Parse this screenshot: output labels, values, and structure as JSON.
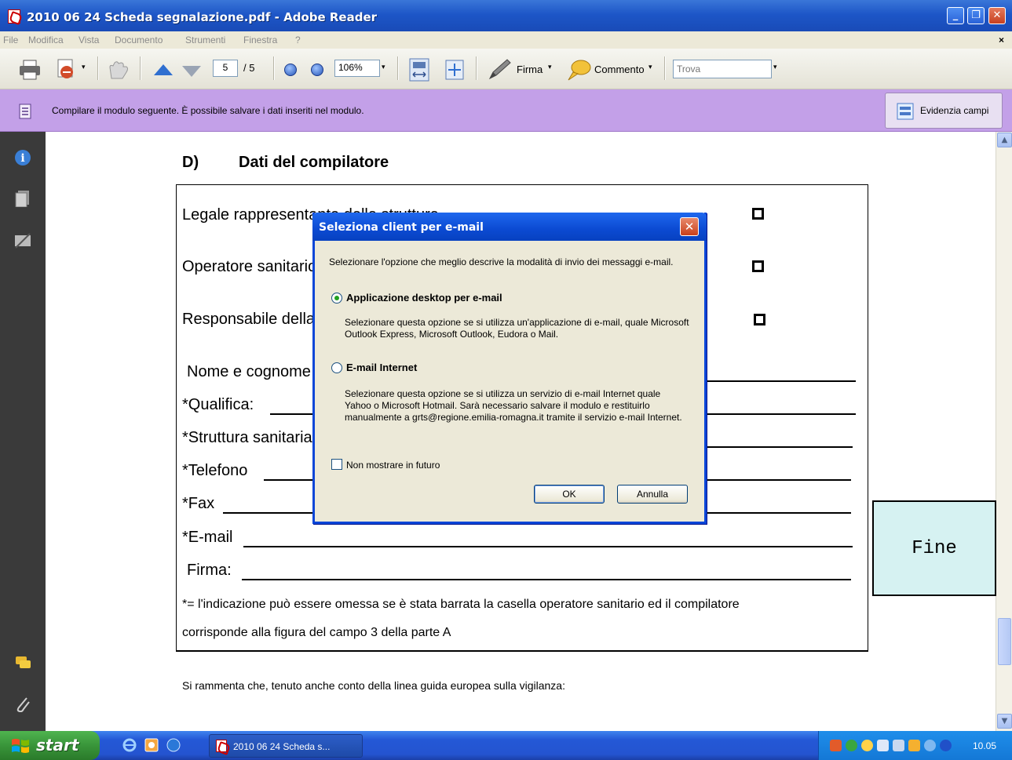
{
  "window": {
    "title": "2010 06 24 Scheda segnalazione.pdf - Adobe Reader",
    "minimize": "_",
    "restore": "❐",
    "close": "✕"
  },
  "menu": {
    "items": [
      "File",
      "Modifica",
      "Vista",
      "Documento",
      "Strumenti",
      "Finestra",
      "?"
    ],
    "close": "×"
  },
  "toolbar": {
    "page_current": "5",
    "page_total": "/ 5",
    "zoom": "106%",
    "firma": "Firma",
    "commento": "Commento",
    "search_placeholder": "Trova"
  },
  "banner": {
    "message": "Compilare il modulo seguente. È possibile salvare i dati inseriti nel modulo.",
    "highlight_button": "Evidenzia campi"
  },
  "document": {
    "section_letter": "D)",
    "section_title": "Dati del compilatore",
    "rows": {
      "legale": "Legale rappresentante della struttura",
      "operatore": "Operatore sanitario",
      "responsabile": "Responsabile della vigilanza",
      "nome": "Nome e cognome",
      "qualifica": "*Qualifica:",
      "struttura": "*Struttura sanitaria",
      "telefono": "*Telefono",
      "fax": "*Fax",
      "email": "*E-mail",
      "firma": "Firma:"
    },
    "footnote_line1": "*= l'indicazione può essere omessa se è stata barrata la casella operatore sanitario ed il compilatore",
    "footnote_line2": "corrisponde alla figura del campo 3 della parte A",
    "reminder": "Si rammenta che, tenuto anche conto della linea guida europea sulla vigilanza:"
  },
  "fine_button": "Fine",
  "dialog": {
    "title": "Seleziona client per e-mail",
    "intro": "Selezionare l'opzione che meglio descrive la modalità di invio dei messaggi e-mail.",
    "option1_label": "Applicazione desktop per e-mail",
    "option1_desc": "Selezionare questa opzione se si utilizza un'applicazione di e-mail, quale Microsoft Outlook Express, Microsoft Outlook, Eudora o Mail.",
    "option2_label": "E-mail Internet",
    "option2_desc": "Selezionare questa opzione se si utilizza un servizio di e-mail Internet quale Yahoo o Microsoft Hotmail. Sarà necessario salvare il modulo e restituirlo manualmente a grts@regione.emilia-romagna.it tramite il servizio e-mail Internet.",
    "checkbox_label": "Non mostrare in futuro",
    "ok": "OK",
    "cancel": "Annulla",
    "selected_option": "option1"
  },
  "taskbar": {
    "start": "start",
    "task": "2010 06 24 Scheda s...",
    "clock": "10.05"
  },
  "colors": {
    "banner": "#c3a0e8",
    "titlebar": "#1d56c7",
    "fine_bg": "#d6f2f2"
  }
}
